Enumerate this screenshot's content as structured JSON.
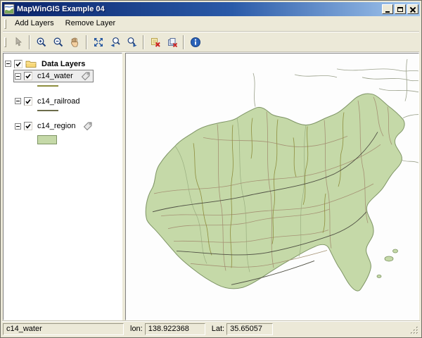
{
  "window": {
    "title": "MapWinGIS Example 04",
    "controls": [
      {
        "name": "minimize"
      },
      {
        "name": "maximize"
      },
      {
        "name": "close"
      }
    ]
  },
  "menu": {
    "items": [
      {
        "label": "Add Layers"
      },
      {
        "label": "Remove Layer"
      }
    ]
  },
  "toolbar": {
    "buttons": [
      {
        "name": "pointer",
        "enabled": false
      },
      {
        "name": "zoom-in",
        "enabled": true
      },
      {
        "name": "zoom-out",
        "enabled": true
      },
      {
        "name": "pan",
        "enabled": true
      },
      {
        "name": "zoom-full-extent",
        "enabled": true
      },
      {
        "name": "zoom-previous",
        "enabled": true
      },
      {
        "name": "zoom-next",
        "enabled": true
      },
      {
        "name": "remove-layer",
        "enabled": true
      },
      {
        "name": "clear-layers",
        "enabled": true
      },
      {
        "name": "info",
        "enabled": true
      }
    ]
  },
  "layers_panel": {
    "root": {
      "label": "Data Layers",
      "checked": true,
      "expanded": true
    },
    "items": [
      {
        "label": "c14_water",
        "checked": true,
        "selected": true,
        "has_tag": true,
        "legend_type": "line",
        "legend_color": "#8e8e3e"
      },
      {
        "label": "c14_railroad",
        "checked": true,
        "selected": false,
        "has_tag": false,
        "legend_type": "line",
        "legend_color": "#6b6b4a"
      },
      {
        "label": "c14_region",
        "checked": true,
        "selected": false,
        "has_tag": true,
        "legend_type": "fill",
        "legend_color": "#c5d9a8"
      }
    ]
  },
  "map": {
    "region_fill": "#c5d9a8",
    "region_border": "#7e9465",
    "water_line": "#8e8e3e",
    "road_line": "#a59274",
    "railroad_line": "#4f4f43"
  },
  "status": {
    "layer": "c14_water",
    "lon_label": "lon:",
    "lon_value": "138.922368",
    "lat_label": "Lat:",
    "lat_value": "35.65057"
  },
  "colors": {
    "titlebar_start": "#0a246a",
    "titlebar_end": "#a6caf0",
    "chrome": "#ece9d8",
    "selection_border": "#808080",
    "selection_bg": "#ededed"
  }
}
